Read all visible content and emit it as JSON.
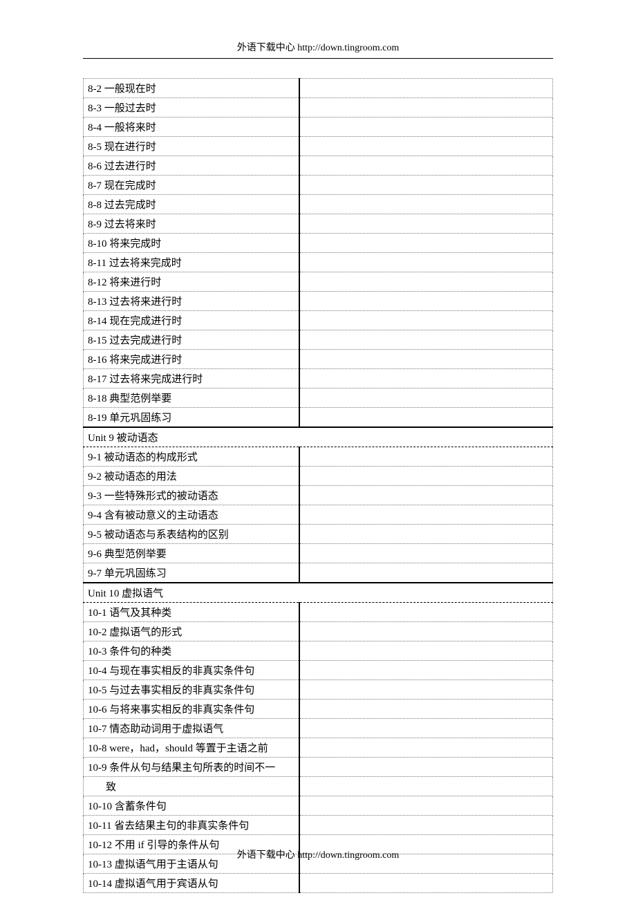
{
  "header": "外语下载中心  http://down.tingroom.com",
  "footer": "外语下载中心  http://down.tingroom.com",
  "sections": [
    {
      "header": null,
      "items": [
        "8-2 一般现在时",
        "8-3 一般过去时",
        "8-4 一般将来时",
        "8-5 现在进行时",
        "8-6 过去进行时",
        "8-7 现在完成时",
        "8-8 过去完成时",
        "8-9 过去将来时",
        "8-10 将来完成时",
        "8-11 过去将来完成时",
        "8-12 将来进行时",
        "8-13 过去将来进行时",
        "8-14 现在完成进行时",
        "8-15 过去完成进行时",
        "8-16 将来完成进行时",
        "8-17 过去将来完成进行时",
        "8-18 典型范例举要",
        "8-19 单元巩固练习"
      ]
    },
    {
      "header": "Unit 9  被动语态",
      "items": [
        "9-1 被动语态的构成形式",
        "9-2 被动语态的用法",
        "9-3 一些特殊形式的被动语态",
        "9-4 含有被动意义的主动语态",
        "9-5 被动语态与系表结构的区别",
        "9-6 典型范例举要",
        "9-7 单元巩固练习"
      ]
    },
    {
      "header": "Unit 10  虚拟语气",
      "items": [
        "10-1 语气及其种类",
        "10-2 虚拟语气的形式",
        "10-3 条件句的种类",
        "10-4 与现在事实相反的非真实条件句",
        "10-5 与过去事实相反的非真实条件句",
        "10-6 与将来事实相反的非真实条件句",
        "10-7 情态助动词用于虚拟语气",
        "10-8 were，had，should 等置于主语之前",
        "10-9 条件从句与结果主句所表的时间不一",
        "10-9b        致",
        "10-10 含蓄条件句",
        "10-11 省去结果主句的非真实条件句",
        "10-12 不用 if 引导的条件从句",
        "10-13 虚拟语气用于主语从句",
        "10-14 虚拟语气用于宾语从句"
      ]
    }
  ]
}
